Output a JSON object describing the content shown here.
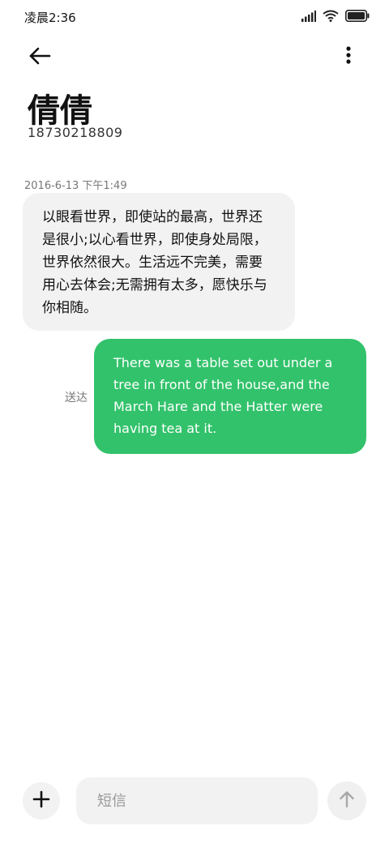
{
  "status_bar": {
    "time": "凌晨2:36",
    "icons": [
      "signal-icon",
      "wifi-icon",
      "battery-icon"
    ]
  },
  "header": {
    "back_icon": "arrow-left-icon",
    "more_icon": "more-vert-icon"
  },
  "contact": {
    "name": "倩倩",
    "number": "18730218809"
  },
  "conversation": {
    "timestamp": "2016-6-13 下午1:49",
    "incoming_message": "以眼看世界，即使站的最高，世界还是很小;以心看世界，即使身处局限，世界依然很大。生活远不完美，需要用心去体会;无需拥有太多，愿快乐与你相随。",
    "outgoing_message": "There was a table set out under a tree in front of the house,and the March Hare and the Hatter were having tea at it.",
    "delivery_status": "送达"
  },
  "composer": {
    "add_icon": "plus-icon",
    "placeholder": "短信",
    "value": "",
    "send_icon": "arrow-up-icon"
  },
  "colors": {
    "outgoing_bubble": "#32c26b",
    "incoming_bubble": "#f2f2f2",
    "background": "#ffffff"
  }
}
